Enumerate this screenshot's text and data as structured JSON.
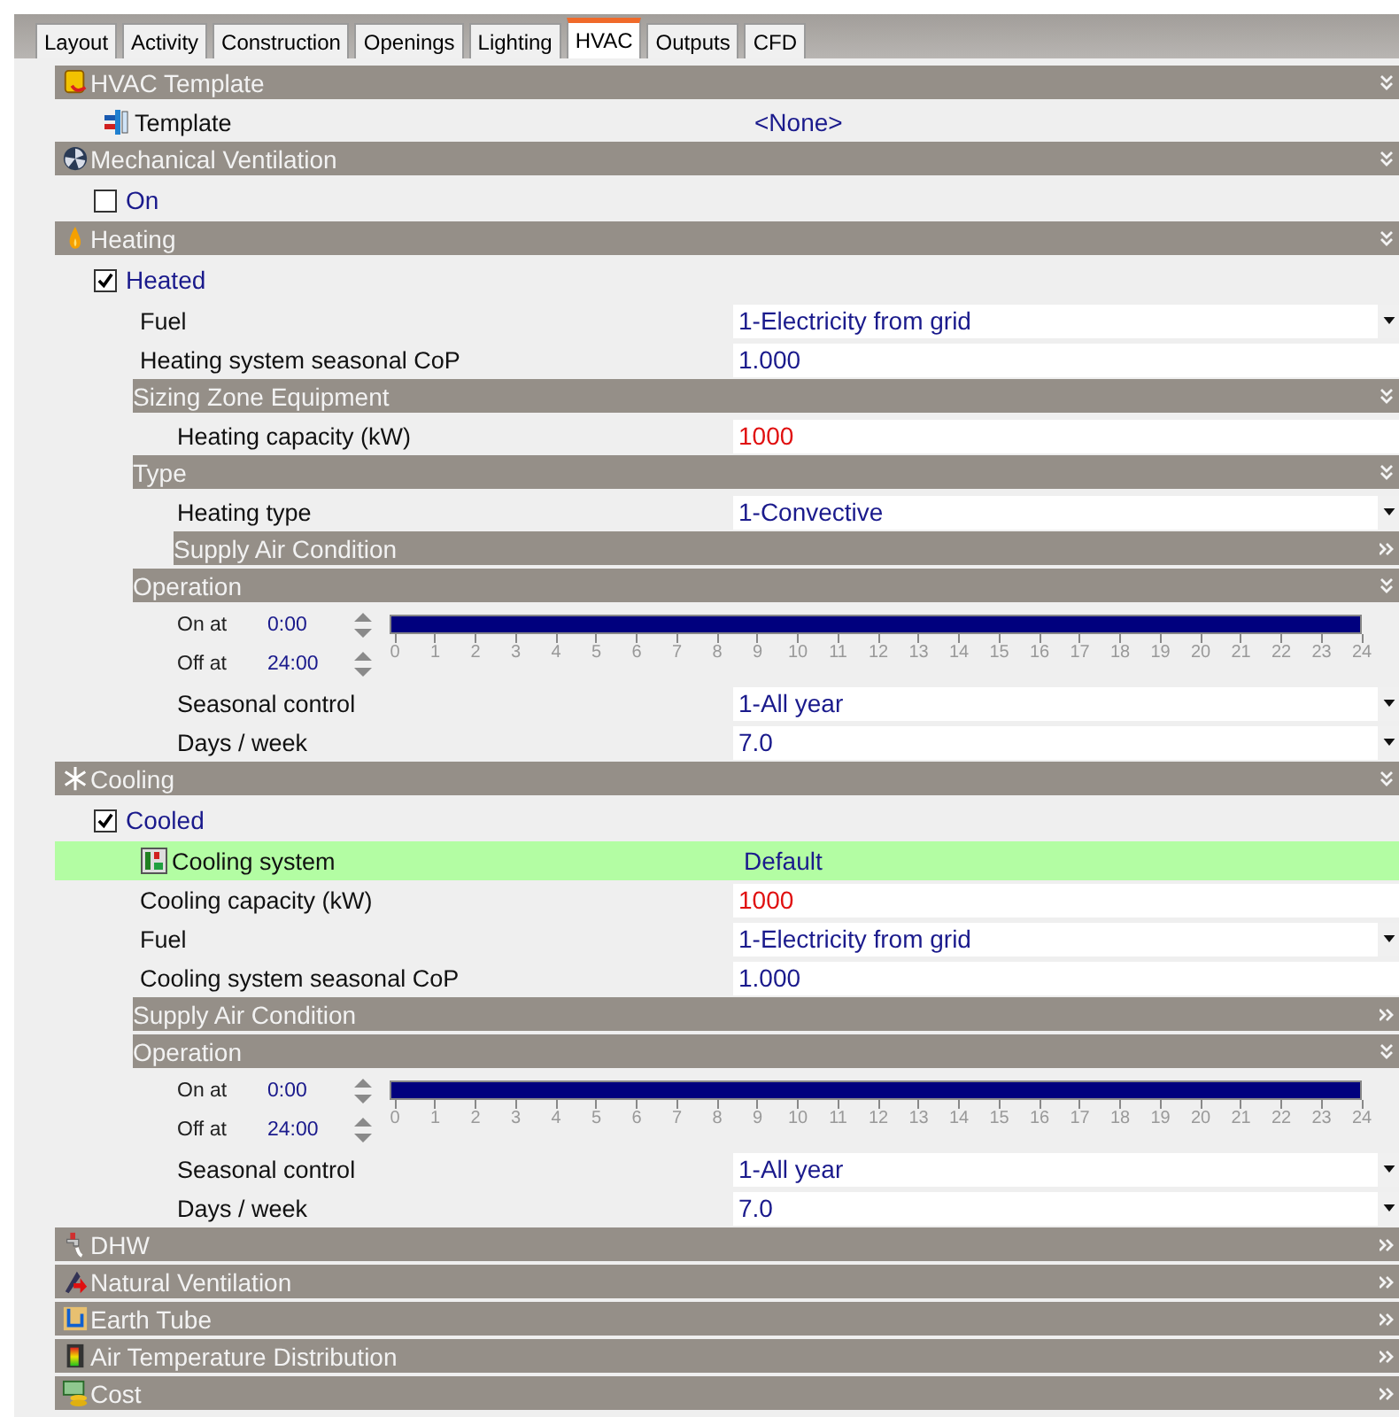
{
  "tabs": [
    {
      "label": "Layout",
      "selected": false
    },
    {
      "label": "Activity",
      "selected": false
    },
    {
      "label": "Construction",
      "selected": false
    },
    {
      "label": "Openings",
      "selected": false
    },
    {
      "label": "Lighting",
      "selected": false
    },
    {
      "label": "HVAC",
      "selected": true
    },
    {
      "label": "Outputs",
      "selected": false
    },
    {
      "label": "CFD",
      "selected": false
    }
  ],
  "sections": [
    {
      "kind": "section",
      "title": "HVAC Template",
      "expanded": true,
      "children": [
        {
          "kind": "link",
          "label": "Template",
          "value": "<None>"
        }
      ]
    },
    {
      "kind": "section",
      "title": "Mechanical Ventilation",
      "expanded": true,
      "children": [
        {
          "kind": "checkbox",
          "label": "On",
          "checked": false
        }
      ]
    },
    {
      "kind": "section",
      "title": "Heating",
      "expanded": true,
      "children": [
        {
          "kind": "checkbox",
          "label": "Heated",
          "checked": true
        },
        {
          "kind": "field",
          "label": "Fuel",
          "value": "1-Electricity from grid",
          "dropdown": true,
          "warning": false
        },
        {
          "kind": "field",
          "label": "Heating system seasonal CoP",
          "value": "1.000",
          "dropdown": false,
          "warning": false
        },
        {
          "kind": "section",
          "title": "Sizing Zone Equipment",
          "expanded": true,
          "children": [
            {
              "kind": "field",
              "label": "Heating capacity (kW)",
              "value": "1000",
              "dropdown": false,
              "warning": true
            }
          ]
        },
        {
          "kind": "section",
          "title": "Type",
          "expanded": true,
          "children": [
            {
              "kind": "field",
              "label": "Heating type",
              "value": "1-Convective",
              "dropdown": true,
              "warning": false
            },
            {
              "kind": "section",
              "title": "Supply Air Condition",
              "expanded": false
            }
          ]
        },
        {
          "kind": "section",
          "title": "Operation",
          "expanded": true,
          "children": [
            {
              "kind": "schedule",
              "on_label": "On at",
              "on_value": "0:00",
              "off_label": "Off at",
              "off_value": "24:00",
              "level": 1,
              "ticks": [
                "0",
                "1",
                "2",
                "3",
                "4",
                "5",
                "6",
                "7",
                "8",
                "9",
                "10",
                "11",
                "12",
                "13",
                "14",
                "15",
                "16",
                "17",
                "18",
                "19",
                "20",
                "21",
                "22",
                "23",
                "24"
              ]
            },
            {
              "kind": "field",
              "label": "Seasonal control",
              "value": "1-All year",
              "dropdown": true,
              "warning": false
            },
            {
              "kind": "field",
              "label": "Days / week",
              "value": "7.0",
              "dropdown": true,
              "warning": false
            }
          ]
        }
      ]
    },
    {
      "kind": "section",
      "title": "Cooling",
      "expanded": true,
      "children": [
        {
          "kind": "checkbox",
          "label": "Cooled",
          "checked": true
        },
        {
          "kind": "highlight",
          "label": "Cooling system",
          "value": "Default"
        },
        {
          "kind": "field",
          "label": "Cooling capacity (kW)",
          "value": "1000",
          "dropdown": false,
          "warning": true
        },
        {
          "kind": "field",
          "label": "Fuel",
          "value": "1-Electricity from grid",
          "dropdown": true,
          "warning": false
        },
        {
          "kind": "field",
          "label": "Cooling system seasonal CoP",
          "value": "1.000",
          "dropdown": false,
          "warning": false
        },
        {
          "kind": "section",
          "title": "Supply Air Condition",
          "expanded": false
        },
        {
          "kind": "section",
          "title": "Operation",
          "expanded": true,
          "children": [
            {
              "kind": "schedule",
              "on_label": "On at",
              "on_value": "0:00",
              "off_label": "Off at",
              "off_value": "24:00",
              "level": 1,
              "ticks": [
                "0",
                "1",
                "2",
                "3",
                "4",
                "5",
                "6",
                "7",
                "8",
                "9",
                "10",
                "11",
                "12",
                "13",
                "14",
                "15",
                "16",
                "17",
                "18",
                "19",
                "20",
                "21",
                "22",
                "23",
                "24"
              ]
            },
            {
              "kind": "field",
              "label": "Seasonal control",
              "value": "1-All year",
              "dropdown": true,
              "warning": false
            },
            {
              "kind": "field",
              "label": "Days / week",
              "value": "7.0",
              "dropdown": true,
              "warning": false
            }
          ]
        }
      ]
    },
    {
      "kind": "section",
      "title": "DHW",
      "expanded": false
    },
    {
      "kind": "section",
      "title": "Natural Ventilation",
      "expanded": false
    },
    {
      "kind": "section",
      "title": "Earth Tube",
      "expanded": false
    },
    {
      "kind": "section",
      "title": "Air Temperature Distribution",
      "expanded": false
    },
    {
      "kind": "section",
      "title": "Cost",
      "expanded": false
    }
  ]
}
